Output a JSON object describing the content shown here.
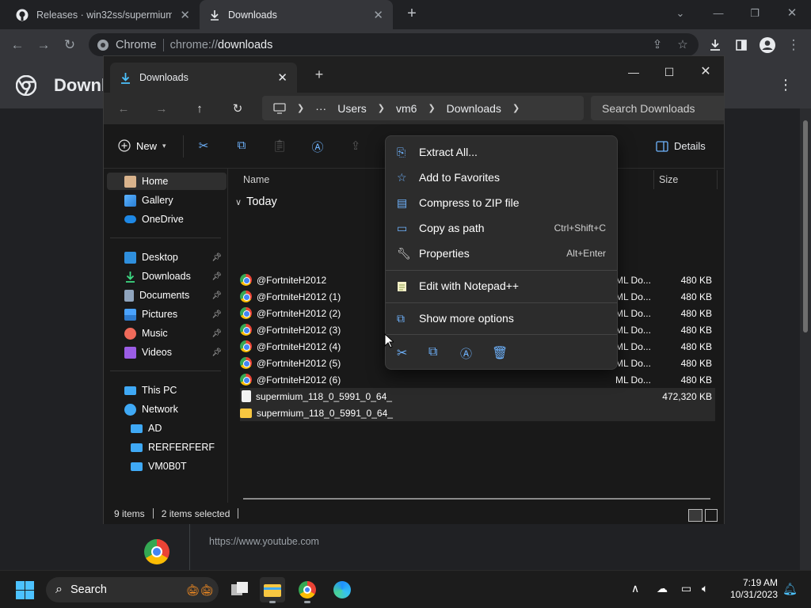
{
  "browser": {
    "tabs": [
      {
        "title": "Releases · win32ss/supermium · GitHub",
        "close": "✕"
      },
      {
        "title": "Downloads",
        "close": "✕"
      }
    ],
    "new_tab": "+",
    "site_label": "Chrome",
    "url_prefix": "chrome://",
    "url_path": "downloads",
    "page_title": "Downloads",
    "page_url_hint": "https://www.youtube.com"
  },
  "explorer": {
    "tab_title": "Downloads",
    "breadcrumb": [
      "Users",
      "vm6",
      "Downloads"
    ],
    "breadcrumb_more": "···",
    "search_placeholder": "Search Downloads",
    "new_label": "New",
    "details_label": "Details",
    "sidebar": {
      "top": [
        {
          "label": "Home",
          "icon": "home-icon",
          "selected": true
        },
        {
          "label": "Gallery",
          "icon": "gallery-icon"
        },
        {
          "label": "OneDrive",
          "icon": "onedrive-icon"
        }
      ],
      "pinned": [
        {
          "label": "Desktop",
          "icon": "desktop-icon"
        },
        {
          "label": "Downloads",
          "icon": "download-icon"
        },
        {
          "label": "Documents",
          "icon": "documents-icon"
        },
        {
          "label": "Pictures",
          "icon": "pictures-icon"
        },
        {
          "label": "Music",
          "icon": "music-icon"
        },
        {
          "label": "Videos",
          "icon": "videos-icon"
        }
      ],
      "bottom": [
        {
          "label": "This PC",
          "icon": "pc-icon"
        },
        {
          "label": "Network",
          "icon": "network-icon"
        },
        {
          "label": "AD",
          "icon": "computer-icon"
        },
        {
          "label": "RERFERFERF",
          "icon": "computer-icon"
        },
        {
          "label": "VM0B0T",
          "icon": "computer-icon"
        }
      ]
    },
    "columns": {
      "name": "Name",
      "size": "Size"
    },
    "group": "Today",
    "files": [
      {
        "name": "@FortniteH2012",
        "type": "ML Do...",
        "size": "480 KB"
      },
      {
        "name": "@FortniteH2012 (1)",
        "type": "ML Do...",
        "size": "480 KB"
      },
      {
        "name": "@FortniteH2012 (2)",
        "type": "ML Do...",
        "size": "480 KB"
      },
      {
        "name": "@FortniteH2012 (3)",
        "type": "ML Do...",
        "size": "480 KB"
      },
      {
        "name": "@FortniteH2012 (4)",
        "type": "ML Do...",
        "size": "480 KB"
      },
      {
        "name": "@FortniteH2012 (5)",
        "type": "ML Do...",
        "size": "480 KB"
      },
      {
        "name": "@FortniteH2012 (6)",
        "type": "ML Do...",
        "size": "480 KB"
      },
      {
        "name": "supermium_118_0_5991_0_64_",
        "type": "",
        "size": "472,320 KB",
        "selected": true
      },
      {
        "name": "supermium_118_0_5991_0_64_",
        "type": "",
        "size": "",
        "selected": true
      }
    ],
    "status": {
      "count": "9 items",
      "selected": "2 items selected"
    }
  },
  "context_menu": {
    "items": [
      {
        "label": "Extract All...",
        "shortcut": ""
      },
      {
        "label": "Add to Favorites",
        "shortcut": ""
      },
      {
        "label": "Compress to ZIP file",
        "shortcut": ""
      },
      {
        "label": "Copy as path",
        "shortcut": "Ctrl+Shift+C"
      },
      {
        "label": "Properties",
        "shortcut": "Alt+Enter"
      },
      {
        "label": "Edit with Notepad++",
        "shortcut": ""
      },
      {
        "label": "Show more options",
        "shortcut": ""
      }
    ]
  },
  "taskbar": {
    "search_label": "Search",
    "time": "7:19 AM",
    "date": "10/31/2023"
  },
  "colors": {
    "accent": "#4cc2ff",
    "folder": "#f8c741"
  }
}
